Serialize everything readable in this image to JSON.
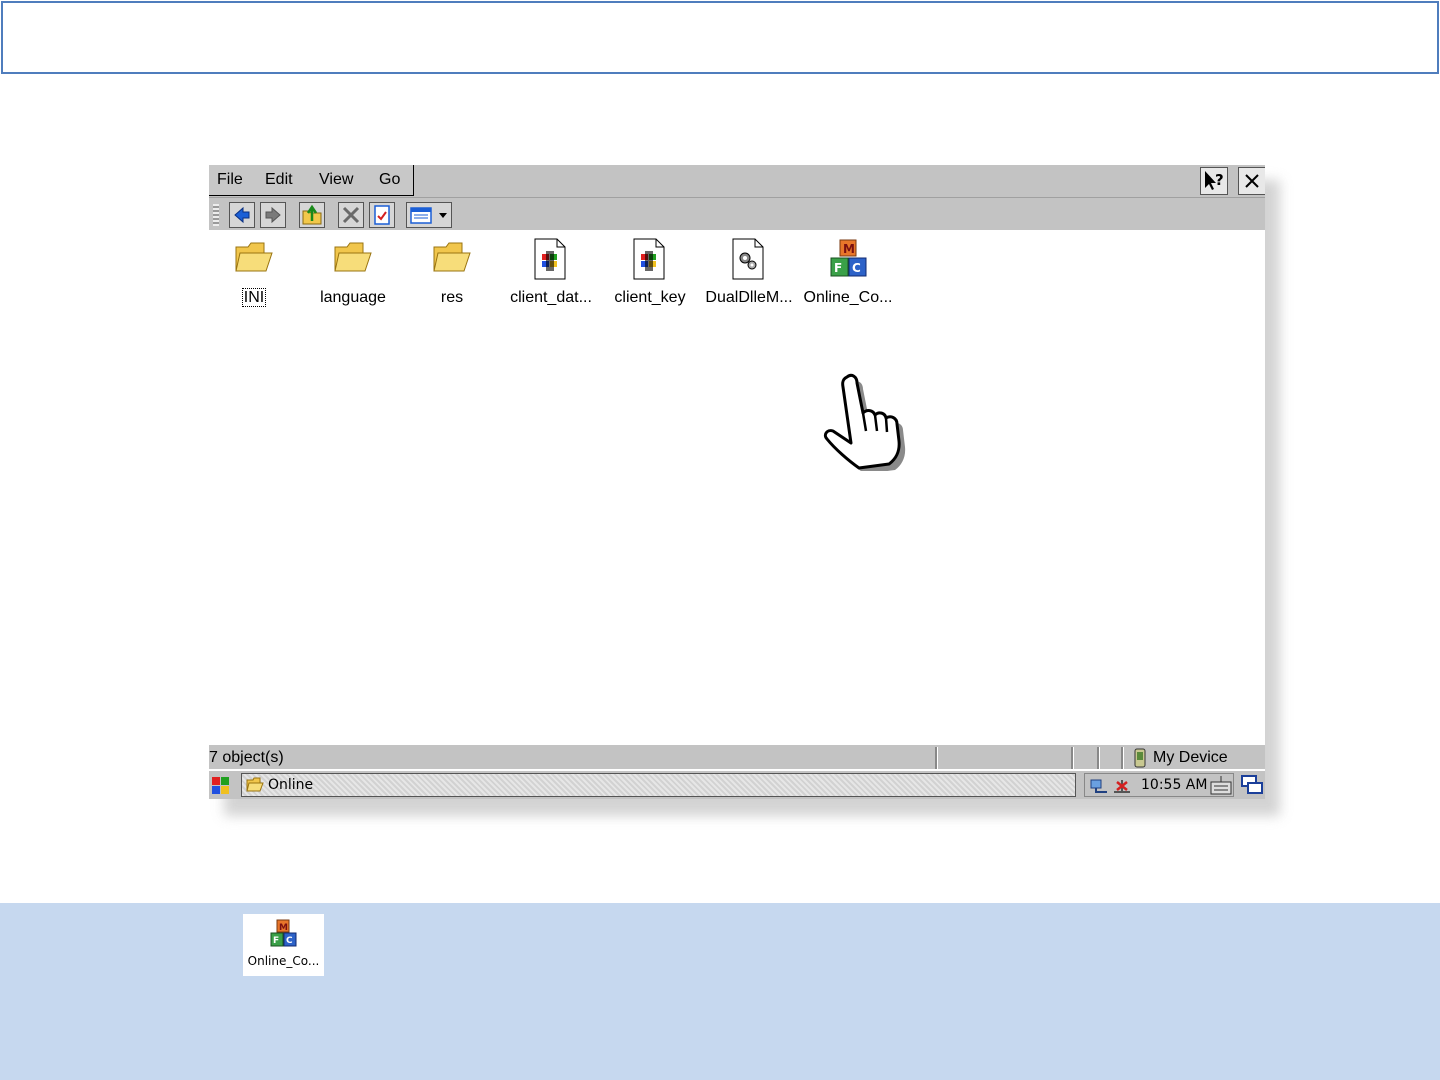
{
  "menu": {
    "file": "File",
    "edit": "Edit",
    "view": "View",
    "go": "Go"
  },
  "files": [
    {
      "name": "INI",
      "type": "folder"
    },
    {
      "name": "language",
      "type": "folder"
    },
    {
      "name": "res",
      "type": "folder"
    },
    {
      "name": "client_dat...",
      "type": "file-win"
    },
    {
      "name": "client_key",
      "type": "file-win"
    },
    {
      "name": "DualDlleM...",
      "type": "file-gear"
    },
    {
      "name": "Online_Co...",
      "type": "mfc-app"
    }
  ],
  "status": {
    "count": "7 object(s)",
    "device": "My Device"
  },
  "taskbar": {
    "window": "Online",
    "time": "10:55 AM"
  },
  "highlight": {
    "label": "Online_Co..."
  },
  "colors": {
    "frame_border": "#4f7dbd",
    "bottom_panel": "#c6d8ef",
    "chrome": "#c3c3c3"
  }
}
